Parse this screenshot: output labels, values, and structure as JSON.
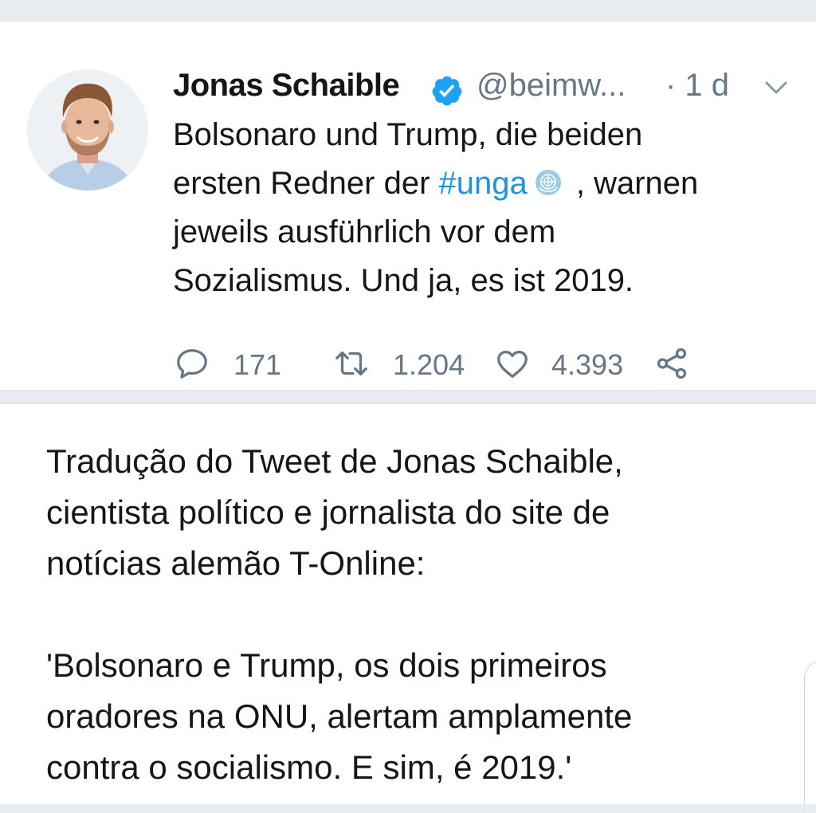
{
  "tweet": {
    "author_name": "Jonas Schaible",
    "handle": "@beimw...",
    "time": "· 1 d",
    "text_lines": [
      "Bolsonaro und Trump, die beiden",
      "ersten Redner der",
      "jeweils ausführlich vor dem",
      "Sozialismus. Und ja, es ist 2019."
    ],
    "hashtag": "#unga",
    "line2_tail": " , warnen",
    "actions": {
      "replies": "171",
      "retweets": "1.204",
      "likes": "4.393"
    }
  },
  "note": {
    "lines_a": [
      "Tradução do Tweet de Jonas Schaible,",
      "cientista político e jornalista do site de",
      "notícias alemão T-Online:"
    ],
    "lines_b": [
      "'Bolsonaro e Trump, os dois primeiros",
      "oradores na ONU, alertam amplamente",
      "contra o socialismo. E sim, é 2019.'"
    ]
  },
  "icons": {
    "verified": "verified-badge-icon",
    "chevron": "chevron-down-icon",
    "reply": "reply-icon",
    "retweet": "retweet-icon",
    "like": "heart-icon",
    "share": "share-icon",
    "un_emoji": "united-nations-emoji"
  },
  "colors": {
    "link": "#1b95e0",
    "secondary_text": "#657786",
    "verified": "#1da1f2",
    "background": "#e6ecf0"
  }
}
